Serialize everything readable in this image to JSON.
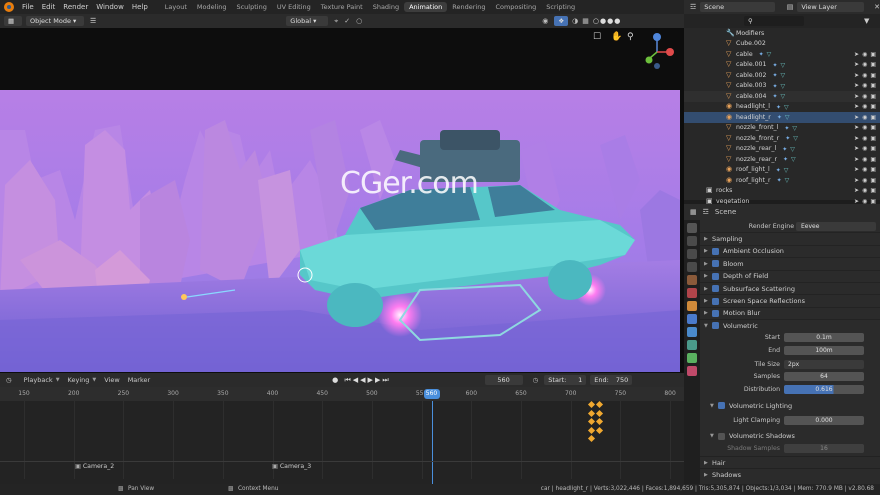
{
  "menu": [
    "File",
    "Edit",
    "Render",
    "Window",
    "Help"
  ],
  "workspaces": [
    {
      "label": "Layout",
      "active": false
    },
    {
      "label": "Modeling",
      "active": false
    },
    {
      "label": "Sculpting",
      "active": false
    },
    {
      "label": "UV Editing",
      "active": false
    },
    {
      "label": "Texture Paint",
      "active": false
    },
    {
      "label": "Shading",
      "active": false
    },
    {
      "label": "Animation",
      "active": true
    },
    {
      "label": "Rendering",
      "active": false
    },
    {
      "label": "Compositing",
      "active": false
    },
    {
      "label": "Scripting",
      "active": false
    }
  ],
  "scene": {
    "name": "Scene",
    "view_layer": "View Layer"
  },
  "viewport": {
    "mode": "Object Mode",
    "transform": "Global",
    "watermark": "CGer.com"
  },
  "outliner": {
    "rows": [
      {
        "label": "Modifiers",
        "icon": "wrench-icon",
        "state": ""
      },
      {
        "label": "Cube.002",
        "icon": "triangle-icon",
        "state": ""
      },
      {
        "label": "cable",
        "icon": "triangle-icon",
        "state": ""
      },
      {
        "label": "cable.001",
        "icon": "triangle-icon",
        "state": ""
      },
      {
        "label": "cable.002",
        "icon": "triangle-icon",
        "state": ""
      },
      {
        "label": "cable.003",
        "icon": "triangle-icon",
        "state": ""
      },
      {
        "label": "cable.004",
        "icon": "triangle-icon",
        "state": "hl"
      },
      {
        "label": "headlight_l",
        "icon": "light-icon",
        "state": ""
      },
      {
        "label": "headlight_r",
        "icon": "light-icon",
        "state": "sel"
      },
      {
        "label": "nozzle_front_l",
        "icon": "triangle-icon",
        "state": ""
      },
      {
        "label": "nozzle_front_r",
        "icon": "triangle-icon",
        "state": ""
      },
      {
        "label": "nozzle_rear_l",
        "icon": "triangle-icon",
        "state": ""
      },
      {
        "label": "nozzle_rear_r",
        "icon": "triangle-icon",
        "state": ""
      },
      {
        "label": "roof_light_l",
        "icon": "light-icon",
        "state": ""
      },
      {
        "label": "roof_light_r",
        "icon": "light-icon",
        "state": ""
      },
      {
        "label": "rocks",
        "icon": "collection-icon",
        "state": ""
      },
      {
        "label": "vegetation",
        "icon": "collection-icon",
        "state": ""
      }
    ]
  },
  "properties": {
    "context": "Scene",
    "render_engine_label": "Render Engine",
    "render_engine": "Eevee",
    "panels": [
      {
        "label": "Sampling",
        "check": null
      },
      {
        "label": "Ambient Occlusion",
        "check": true
      },
      {
        "label": "Bloom",
        "check": true
      },
      {
        "label": "Depth of Field",
        "check": true
      },
      {
        "label": "Subsurface Scattering",
        "check": true
      },
      {
        "label": "Screen Space Reflections",
        "check": true
      },
      {
        "label": "Motion Blur",
        "check": true
      },
      {
        "label": "Volumetric",
        "check": true
      }
    ],
    "volumetric": {
      "start_label": "Start",
      "start": "0.1m",
      "end_label": "End",
      "end": "100m",
      "tile_label": "Tile Size",
      "tile": "2px",
      "samples_label": "Samples",
      "samples": "64",
      "dist_label": "Distribution",
      "dist": "0.616",
      "lighting_label": "Volumetric Lighting",
      "clamp_label": "Light Clamping",
      "clamp": "0.000",
      "shadows_label": "Volumetric Shadows",
      "shadow_samples_label": "Shadow Samples",
      "shadow_samples": "16"
    },
    "hair_label": "Hair",
    "shadows_label": "Shadows"
  },
  "timeline": {
    "menus": [
      "Playback",
      "Keying",
      "View",
      "Marker"
    ],
    "current_frame": "560",
    "start_label": "Start:",
    "start": "1",
    "end_label": "End:",
    "end": "750",
    "ruler": [
      "150",
      "200",
      "250",
      "300",
      "350",
      "400",
      "450",
      "500",
      "550",
      "600",
      "650",
      "700",
      "750",
      "800"
    ],
    "playhead": "560",
    "markers": [
      "Camera_2",
      "Camera_3"
    ]
  },
  "status": {
    "left": "Pan View",
    "middle": "Context Menu",
    "stats": "car | headlight_r | Verts:3,022,446 | Faces:1,894,659 | Tris:5,305,874 | Objects:1/3,034 | Mem: 770.9 MB | v2.80.68"
  },
  "colors": {
    "accent": "#4672b4",
    "selection": "#334d70",
    "keyframe": "#f0a830",
    "playhead": "#4a8fdc"
  }
}
